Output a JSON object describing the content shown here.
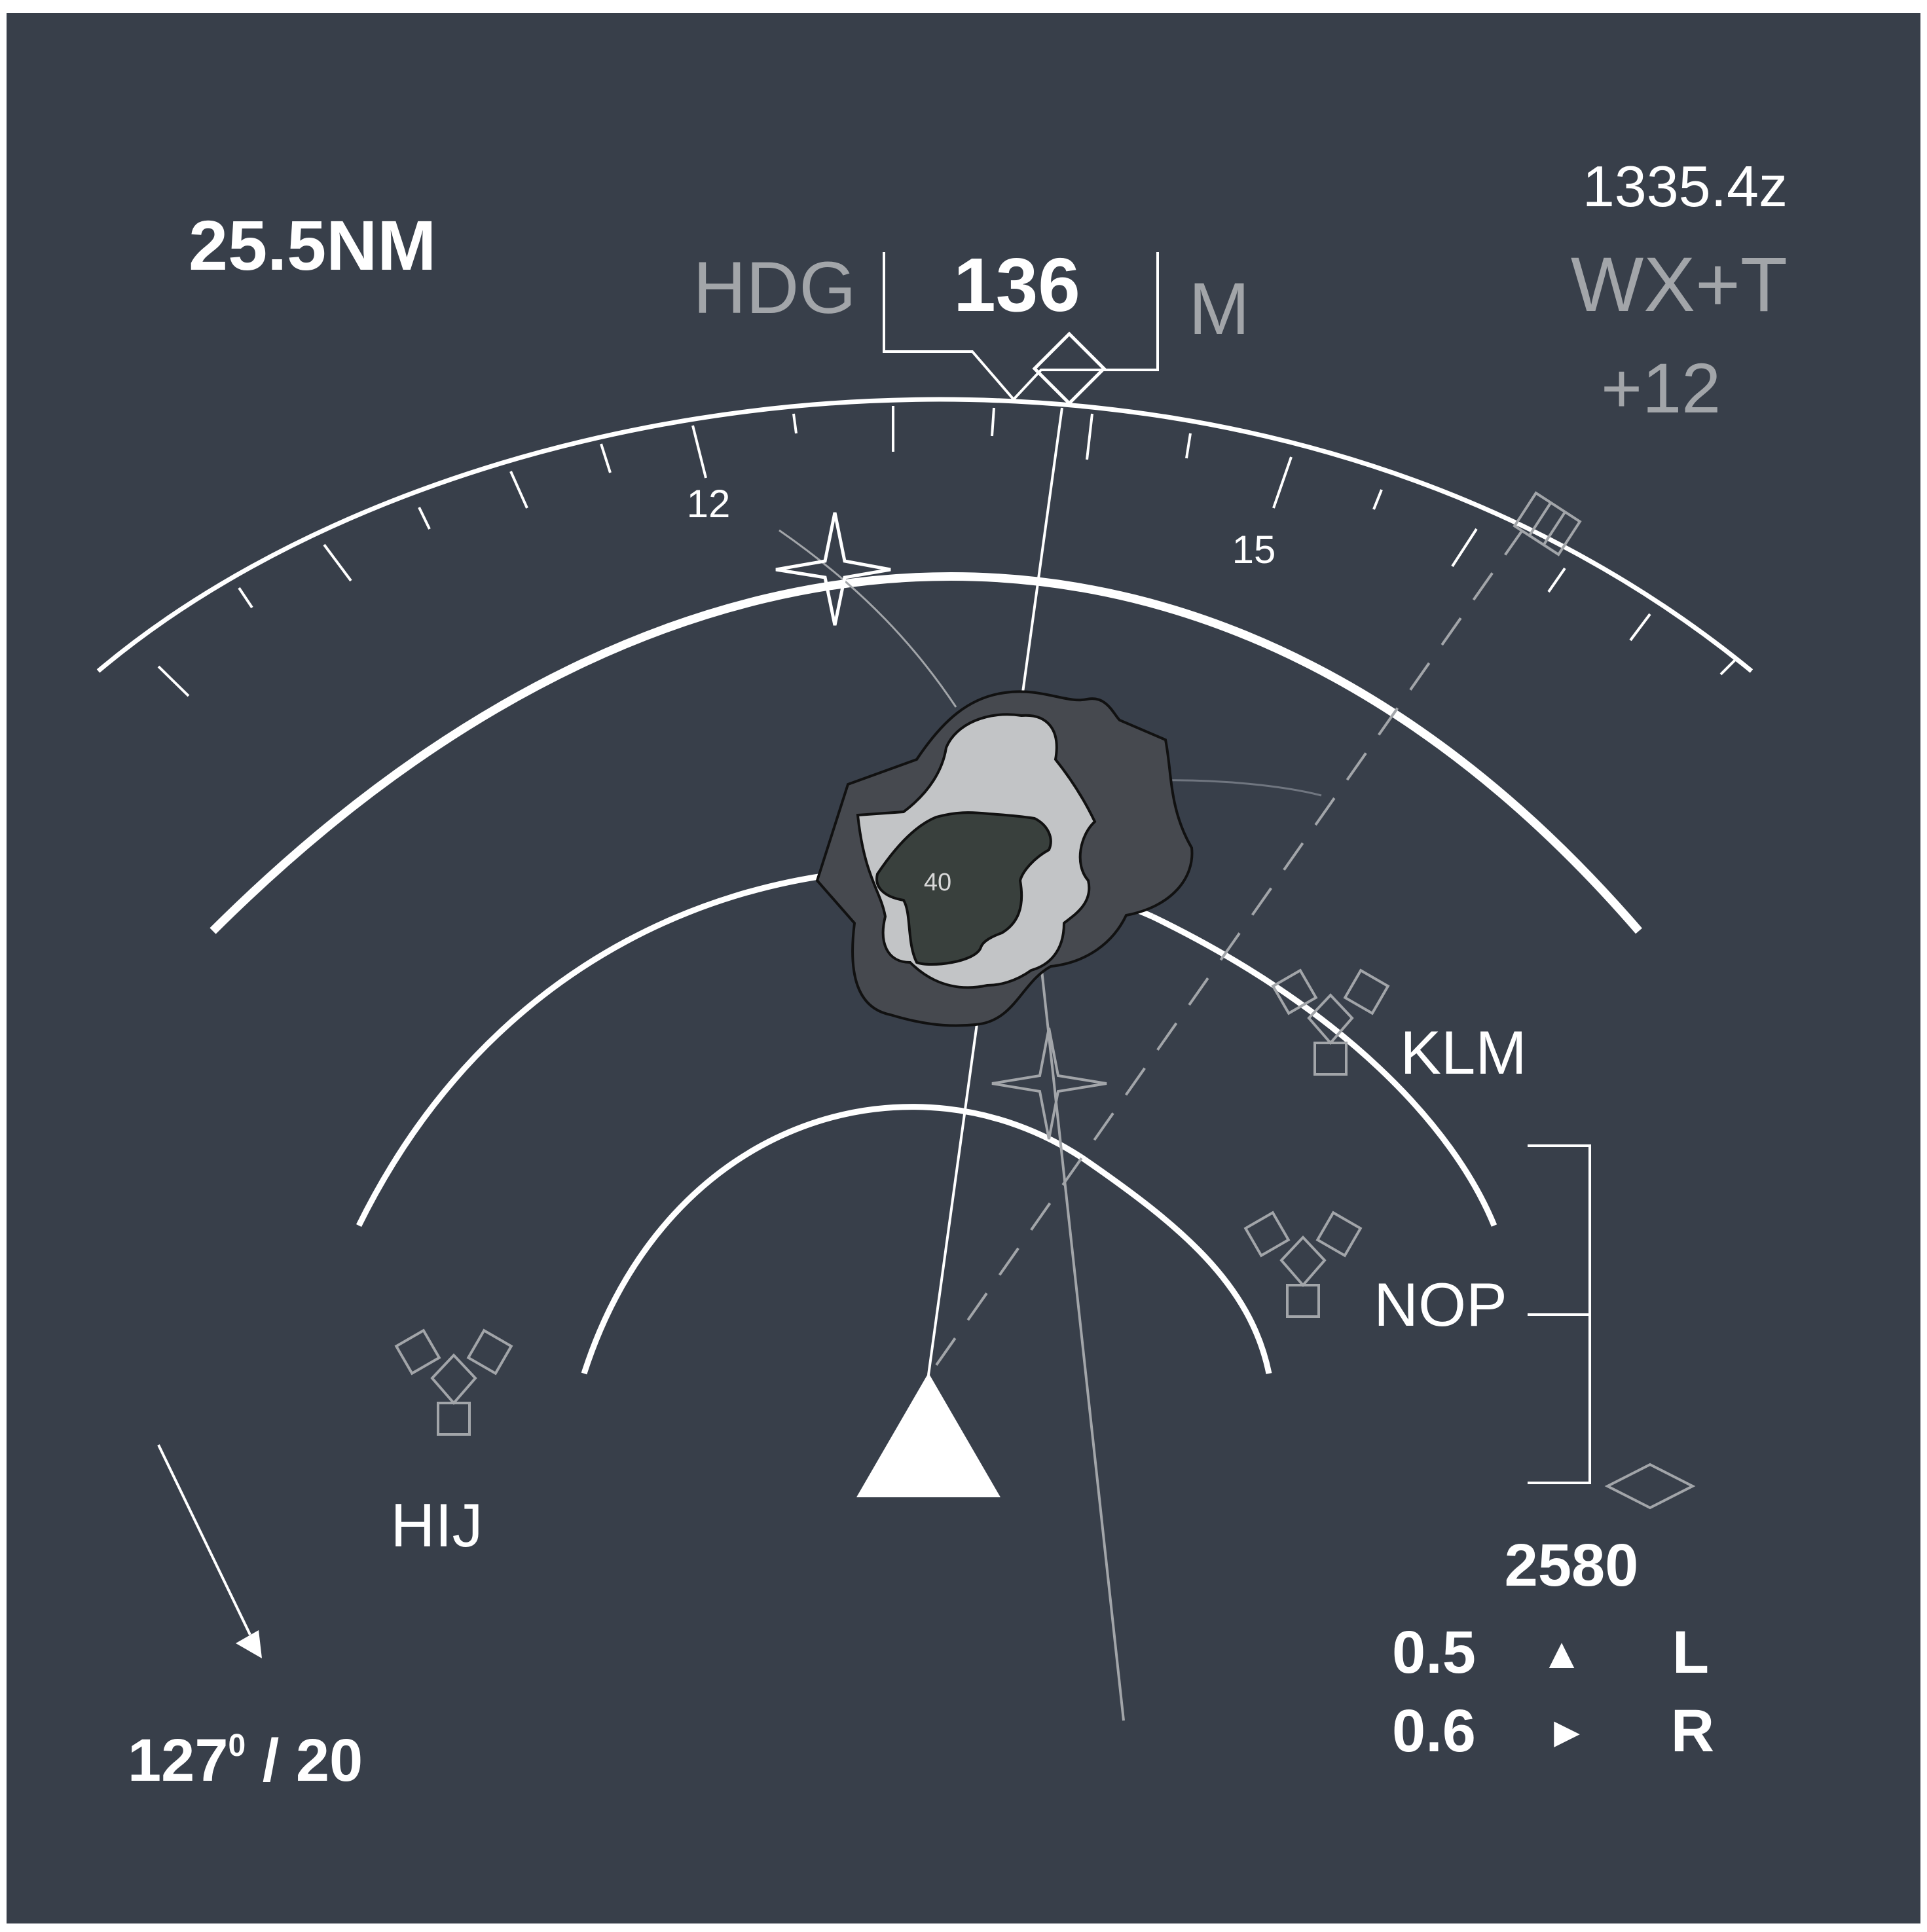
{
  "range_readout": "25.5NM",
  "heading": {
    "label": "HDG",
    "value": "136",
    "reference": "M"
  },
  "clock": "1335.4z",
  "weather_mode": "WX+T",
  "gain": "+12",
  "compass_labels": [
    "12",
    "15"
  ],
  "storm_cell_label": "40",
  "waypoints": [
    "KLM",
    "NOP",
    "HIJ"
  ],
  "altitude": "2580",
  "left_readout": {
    "value": "0.5",
    "symbol": "▲",
    "side": "L"
  },
  "right_readout": {
    "value": "0.6",
    "symbol": "►",
    "side": "R"
  },
  "wind": {
    "direction": "127",
    "degree_mark": "0",
    "separator": " / ",
    "speed": "20"
  },
  "colors": {
    "background": "#383f4a",
    "foreground": "#ffffff",
    "dim": "#a2a5a9",
    "cell_outer": "#46494f",
    "cell_middle": "#c2c4c6",
    "cell_core": "#39403d"
  }
}
